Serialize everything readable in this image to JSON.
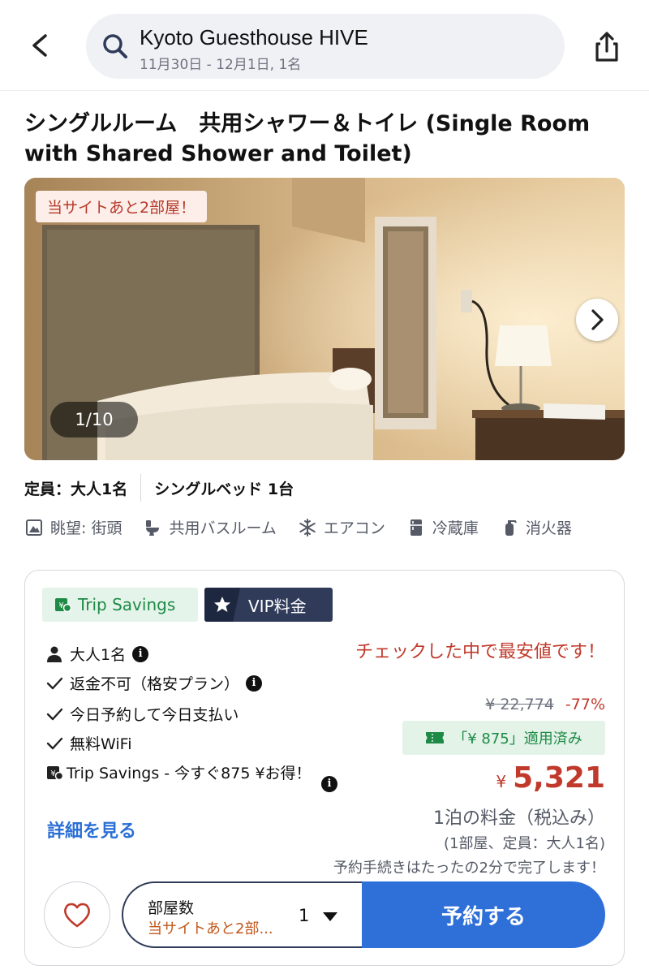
{
  "header": {
    "hotel_name": "Kyoto Guesthouse HIVE",
    "stay_summary": "11月30日 - 12月1日, 1名"
  },
  "room": {
    "title": "シングルルーム　共用シャワー＆トイレ (Single Room with Shared Shower and Toilet)",
    "rooms_left_tag": "当サイトあと2部屋！",
    "photo_counter": "1/10",
    "occupancy": "定員：大人1名",
    "bed": "シングルベッド 1台",
    "amenities": [
      {
        "icon": "view-icon",
        "label": "眺望: 街頭"
      },
      {
        "icon": "toilet-icon",
        "label": "共用バスルーム"
      },
      {
        "icon": "snowflake-icon",
        "label": "エアコン"
      },
      {
        "icon": "fridge-icon",
        "label": "冷蔵庫"
      },
      {
        "icon": "fire-extinguisher-icon",
        "label": "消火器"
      }
    ]
  },
  "rate": {
    "badges": {
      "trip_savings": "Trip Savings",
      "vip": "VIP料金"
    },
    "features": {
      "guests": "大人1名",
      "refund": "返金不可（格安プラン）",
      "payment": "今日予約して今日支払い",
      "wifi": "無料WiFi",
      "trip_savings": "Trip Savings - 今すぐ875 ¥お得！"
    },
    "details_link": "詳細を見る",
    "lowest_price_msg": "チェックした中で最安値です！",
    "original_price": "¥ 22,774",
    "discount": "-77%",
    "coupon": "「¥ 875」適用済み",
    "currency": "¥",
    "price": "5,321",
    "per_night": "1泊の料金（税込み）",
    "per_room": "(1部屋、定員：大人1名)",
    "quick_booking": "予約手続きはたったの2分で完了します！",
    "room_count_label": "部屋数",
    "room_count_sub": "当サイトあと2部...",
    "room_count_value": "1",
    "book_button": "予約する"
  },
  "colors": {
    "accent_blue": "#2f6fd8",
    "price_red": "#c0392b",
    "savings_green": "#1e8a46",
    "vip_navy": "#2f3b59"
  }
}
